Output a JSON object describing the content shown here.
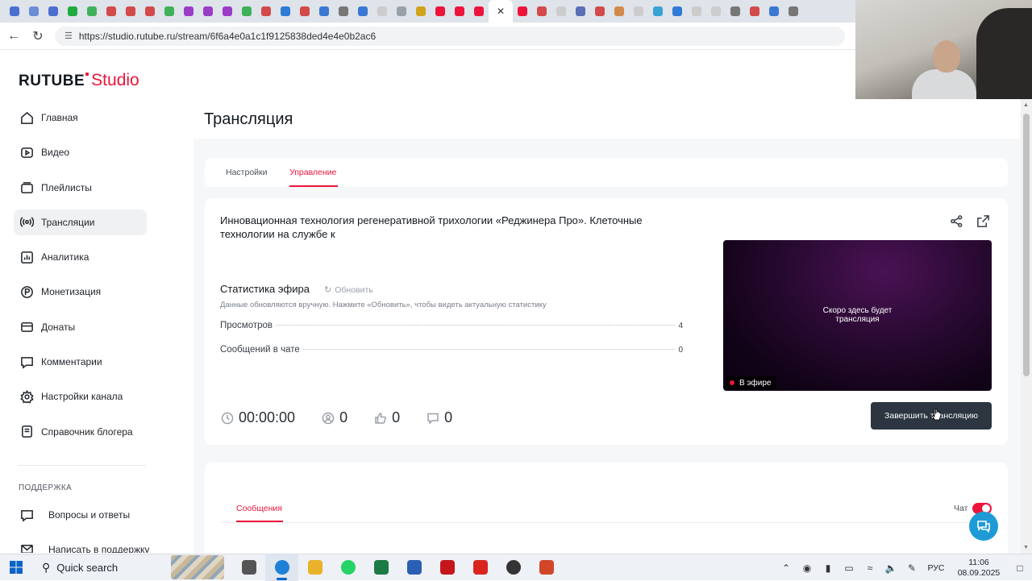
{
  "browser": {
    "url": "https://studio.rutube.ru/stream/6f6a4e0a1c1f9125838ded4e4e0b2ac6",
    "tab_close": "✕",
    "tab_favicon_colors": [
      "#4a6fd1",
      "#6b8dd6",
      "#4a6fd1",
      "#1fab3f",
      "#3fb15b",
      "#d24a4a",
      "#d24a4a",
      "#d24a4a",
      "#3fb15b",
      "#9b3cc7",
      "#9b3cc7",
      "#9b3cc7",
      "#3fb15b",
      "#d24a4a",
      "#2f7bd6",
      "#d24a4a",
      "#3a78d4",
      "#777777",
      "#3a78d4",
      "#cccccc",
      "#9aa0a8",
      "#d2a21a",
      "#ed143b",
      "#ed143b",
      "#ed143b",
      "#ed143b",
      "#d24a4a",
      "#cccccc",
      "#5a6fb5",
      "#d24a4a",
      "#d28a4a",
      "#cccccc",
      "#3aa3d4",
      "#2f7bd6",
      "#cccccc",
      "#cccccc",
      "#777777",
      "#d24a4a",
      "#3a78d4",
      "#777777"
    ]
  },
  "logo": {
    "rutube": "RUTUBE",
    "studio": "Studio"
  },
  "sidebar": {
    "items": [
      {
        "label": "Главная",
        "icon": "home-icon"
      },
      {
        "label": "Видео",
        "icon": "video-icon"
      },
      {
        "label": "Плейлисты",
        "icon": "playlist-icon"
      },
      {
        "label": "Трансляции",
        "icon": "broadcast-icon"
      },
      {
        "label": "Аналитика",
        "icon": "analytics-icon"
      },
      {
        "label": "Монетизация",
        "icon": "money-icon"
      },
      {
        "label": "Донаты",
        "icon": "donate-icon"
      },
      {
        "label": "Комментарии",
        "icon": "comments-icon"
      },
      {
        "label": "Настройки канала",
        "icon": "gear-icon"
      },
      {
        "label": "Справочник блогера",
        "icon": "book-icon"
      }
    ],
    "support_title": "ПОДДЕРЖКА",
    "support_items": [
      {
        "label": "Вопросы и ответы",
        "icon": "question-icon"
      },
      {
        "label": "Написать в поддержку",
        "icon": "mail-icon"
      }
    ]
  },
  "page": {
    "title": "Трансляция",
    "tabs": [
      {
        "label": "Настройки"
      },
      {
        "label": "Управление"
      }
    ]
  },
  "stream": {
    "title": "Инновационная технология регенеративной трихологии «Реджинера Про». Клеточные технологии на службе к",
    "stats_title": "Статистика эфира",
    "refresh_label": "Обновить",
    "stats_note": "Данные обновляются вручную. Нажмите «Обновить», чтобы видеть актуальную статистику",
    "stats": [
      {
        "label": "Просмотров",
        "value": "4"
      },
      {
        "label": "Сообщений в чате",
        "value": "0"
      }
    ],
    "duration": "00:00:00",
    "viewers": "0",
    "likes": "0",
    "dislikes": "0",
    "player_message_line1": "Скоро здесь будет",
    "player_message_line2": "трансляция",
    "live_badge": "В эфире",
    "end_button": "Завершить трансляцию"
  },
  "chat": {
    "tab_label": "Сообщения",
    "toggle_label": "Чат",
    "toggle_on": true
  },
  "taskbar": {
    "search_label": "Quick search",
    "apps": [
      {
        "name": "task-view",
        "color": "#555555"
      },
      {
        "name": "edge",
        "color": "#1e7fd6",
        "active": true
      },
      {
        "name": "file-explorer",
        "color": "#e8b22a"
      },
      {
        "name": "whatsapp",
        "color": "#25d366"
      },
      {
        "name": "excel",
        "color": "#1d7a44"
      },
      {
        "name": "word",
        "color": "#2b5fb4"
      },
      {
        "name": "acrobat",
        "color": "#c4161c"
      },
      {
        "name": "pdf-reader",
        "color": "#d9251d"
      },
      {
        "name": "obs",
        "color": "#333333"
      },
      {
        "name": "powerpoint",
        "color": "#d2462a"
      }
    ],
    "lang": "РУС",
    "time": "11:06",
    "date": "08.09.2025"
  }
}
